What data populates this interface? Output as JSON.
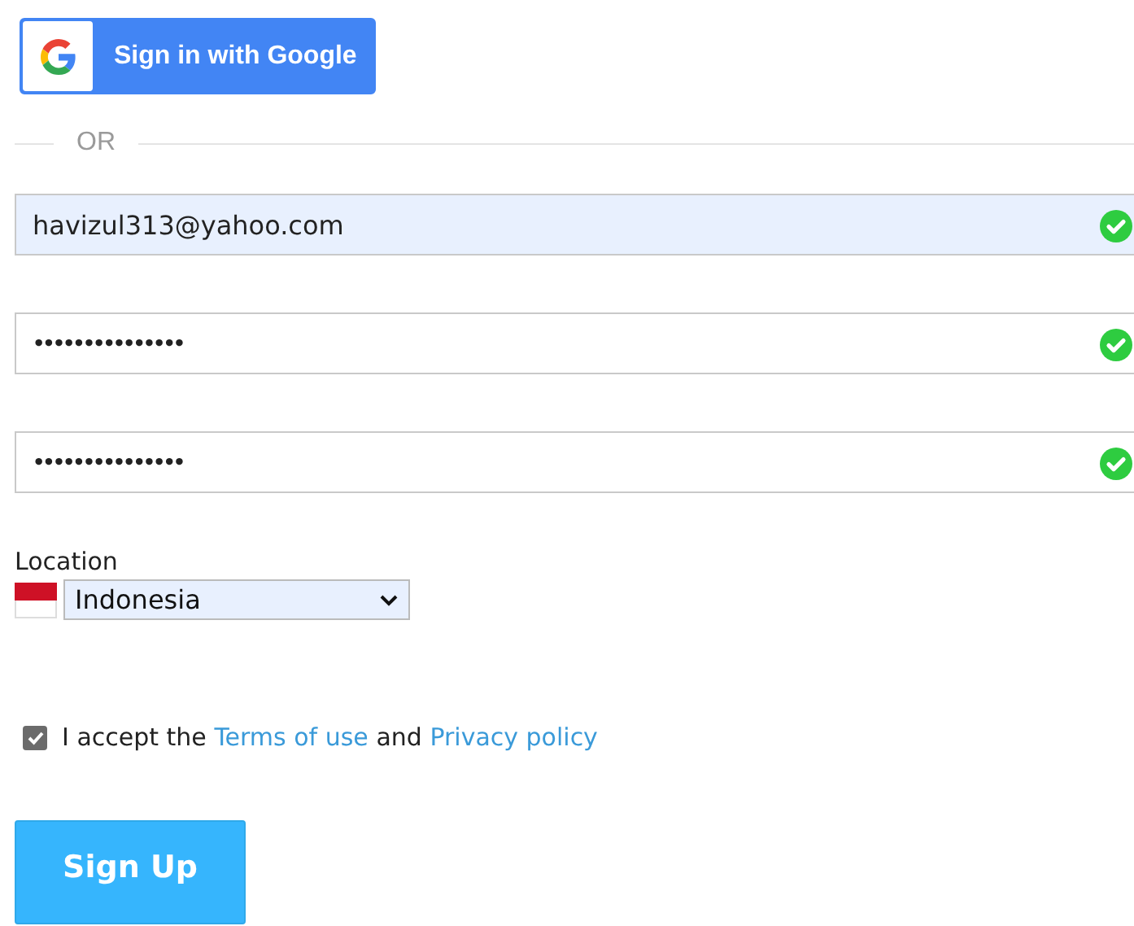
{
  "google_button": {
    "label": "Sign in with Google"
  },
  "divider": {
    "label": "OR"
  },
  "fields": [
    {
      "kind": "email",
      "value": "havizul313@yahoo.com",
      "autofilled": true,
      "valid": true
    },
    {
      "kind": "password",
      "value": "•••••••••••••••",
      "autofilled": false,
      "valid": true
    },
    {
      "kind": "password",
      "value": "•••••••••••••••",
      "autofilled": false,
      "valid": true
    }
  ],
  "location": {
    "label": "Location",
    "value": "Indonesia",
    "autofilled": true
  },
  "terms": {
    "checked": true,
    "text_before": "I accept the",
    "link_1": "Terms of use",
    "joiner": "and",
    "link_2": "Privacy policy"
  },
  "submit": {
    "label": "Sign Up"
  }
}
